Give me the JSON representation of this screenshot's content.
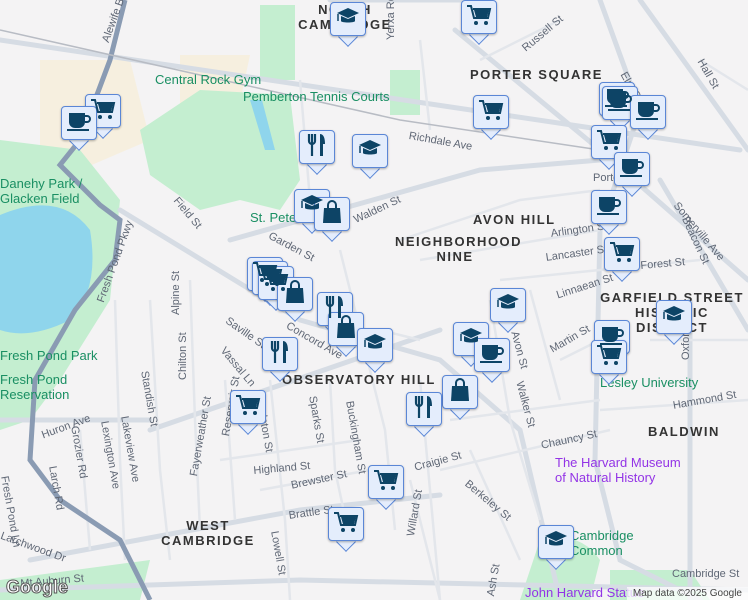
{
  "map": {
    "neighborhoods": [
      "NORTH CAMBRIDGE",
      "PORTER SQUARE",
      "AVON HILL",
      "NEIGHBORHOOD NINE",
      "OBSERVATORY HILL",
      "GARFIELD STREET HISTORIC DISTRICT",
      "BALDWIN",
      "WEST CAMBRIDGE"
    ],
    "pois": [
      "Central Rock Gym",
      "Pemberton Tennis Courts",
      "St. Peter's",
      "Lesley University",
      "Cambridge Common"
    ],
    "museums": [
      "The Harvard Museum of Natural History",
      "John Harvard Statue"
    ],
    "parks": [
      "Fresh Pond Park",
      "Fresh Pond Reservation",
      "Danehy Park / Glacken Field"
    ],
    "streets": [
      "Fresh Pond Pkwy",
      "Alewife Brook Pkwy",
      "Field St",
      "Garden St",
      "Walden St",
      "Richdale Ave",
      "Russell St",
      "Yerxa Rd",
      "Elm St",
      "Somerville Ave",
      "Beacon St",
      "Arlington St",
      "Lancaster St",
      "Forest St",
      "Linnaean St",
      "Huron Ave",
      "Martin St",
      "Avon St",
      "Walker St",
      "Chauncy St",
      "Craigie St",
      "Berkeley St",
      "Willard St",
      "Ash St",
      "Hammond St",
      "Oxford St",
      "Saville St",
      "Vassal Ln",
      "Concord Ave",
      "Alpine St",
      "Standish St",
      "Chilton St",
      "Fayerweather St",
      "Reservoir St",
      "Appleton St",
      "Sparks St",
      "Buckingham St",
      "Highland St",
      "Brewster St",
      "Brattle St",
      "Lowell St",
      "Lakeview Ave",
      "Lexington Ave",
      "Grozier Rd",
      "Larch Rd",
      "Fresh Pond Ln",
      "Larchwood Dr",
      "Mt Auburn St",
      "Cambridge St",
      "Porter",
      "Hall St"
    ],
    "markers": [
      "school",
      "cart",
      "cart",
      "coffee",
      "coffee",
      "coffee",
      "coffee",
      "cart",
      "fork-knife",
      "school",
      "cart",
      "coffee",
      "school",
      "shopping-bag",
      "coffee",
      "cart",
      "cart",
      "cart",
      "cart",
      "shopping-bag",
      "school",
      "fork-knife",
      "shopping-bag",
      "school",
      "school",
      "coffee",
      "school",
      "coffee",
      "cart",
      "fork-knife",
      "cart",
      "shopping-bag",
      "fork-knife",
      "cart",
      "cart",
      "school"
    ]
  },
  "footer": {
    "logo": "Google",
    "attribution": "Map data ©2025 Google"
  },
  "colors": {
    "marker_fill": "#e4edfc",
    "marker_border": "#5a86d6",
    "icon": "#0d4466",
    "park": "#c4eed0",
    "water": "#8fd5ec",
    "highway": "#8a9bb3"
  }
}
